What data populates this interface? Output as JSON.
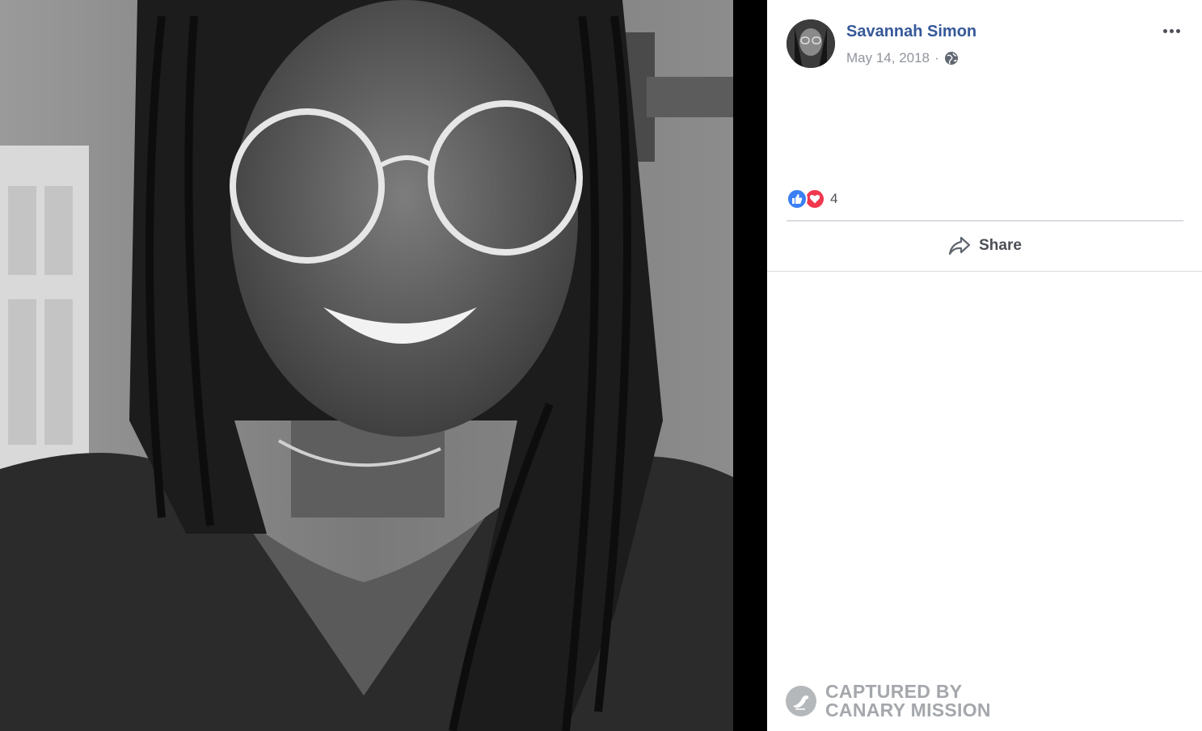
{
  "post": {
    "author": "Savannah Simon",
    "date": "May 14, 2018",
    "separator": "·",
    "privacy_icon": "globe-icon",
    "more_icon": "more-options-icon",
    "reactions": {
      "types": [
        "like",
        "love"
      ],
      "count": "4"
    },
    "actions": {
      "share_label": "Share"
    }
  },
  "watermark": {
    "lines": [
      "CAPTURED BY",
      "CANARY MISSION"
    ]
  },
  "colors": {
    "author_link": "#365899",
    "like": "#3b7ff5",
    "love": "#f0384f",
    "muted": "#90949c"
  }
}
